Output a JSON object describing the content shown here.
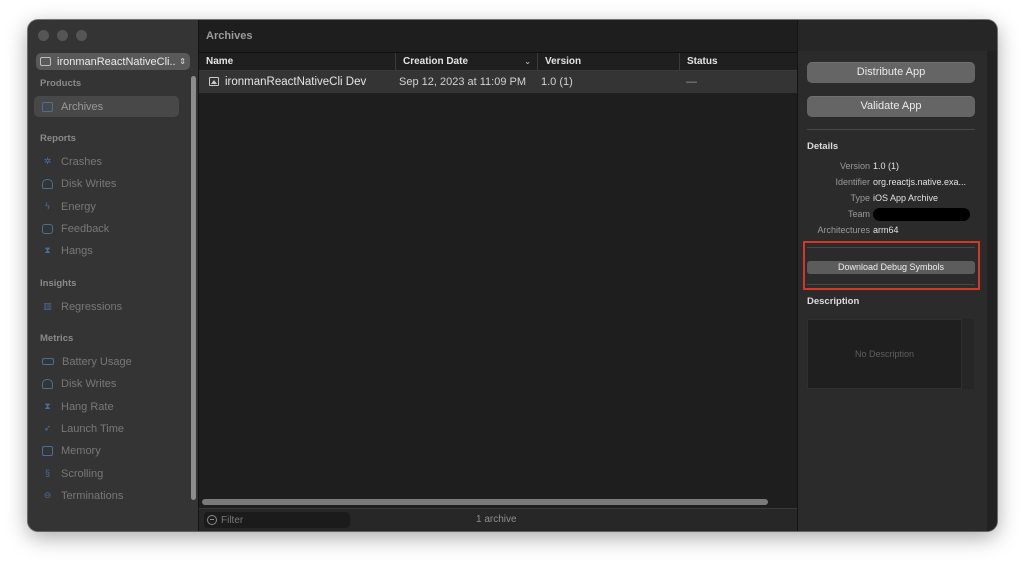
{
  "app_selector": {
    "value": "ironmanReactNativeCli..."
  },
  "sidebar": {
    "sections": {
      "products": "Products",
      "reports": "Reports",
      "insights": "Insights",
      "metrics": "Metrics"
    },
    "items": {
      "archives": "Archives",
      "crashes": "Crashes",
      "disk_writes": "Disk Writes",
      "energy": "Energy",
      "feedback": "Feedback",
      "hangs": "Hangs",
      "regressions": "Regressions",
      "battery_usage": "Battery Usage",
      "disk_writes_metric": "Disk Writes",
      "hang_rate": "Hang Rate",
      "launch_time": "Launch Time",
      "memory": "Memory",
      "scrolling": "Scrolling",
      "terminations": "Terminations"
    },
    "selected": "Archives"
  },
  "main": {
    "title": "Archives",
    "columns": {
      "name": "Name",
      "creation_date": "Creation Date",
      "version": "Version",
      "status": "Status"
    },
    "rows": [
      {
        "name": "ironmanReactNativeCli Dev",
        "creation_date": "Sep 12, 2023 at 11:09 PM",
        "version": "1.0 (1)",
        "status": "—"
      }
    ],
    "filter_placeholder": "Filter",
    "archive_count": "1 archive"
  },
  "inspector": {
    "distribute_button": "Distribute App",
    "validate_button": "Validate App",
    "details_heading": "Details",
    "details": {
      "version_key": "Version",
      "version_value": "1.0 (1)",
      "identifier_key": "Identifier",
      "identifier_value": "org.reactjs.native.exa...",
      "type_key": "Type",
      "type_value": "iOS App Archive",
      "team_key": "Team",
      "architectures_key": "Architectures",
      "architectures_value": "arm64"
    },
    "download_debug_button": "Download Debug Symbols",
    "description_heading": "Description",
    "description_placeholder": "No Description"
  },
  "colors": {
    "highlight": "#d0382c",
    "sidebar_icon": "#4a6f96"
  }
}
